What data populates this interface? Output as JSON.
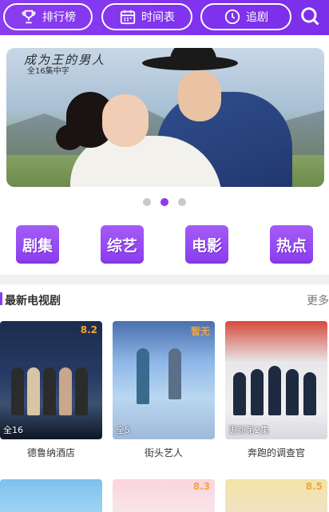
{
  "header": {
    "buttons": [
      {
        "label": "排行榜",
        "icon": "trophy-icon"
      },
      {
        "label": "时间表",
        "icon": "calendar-icon"
      },
      {
        "label": "追剧",
        "icon": "clock-icon"
      }
    ],
    "search_icon": "search-icon",
    "colors": {
      "accent": "#8a3cf0"
    }
  },
  "banner": {
    "title": "成为王的男人",
    "subtitle": "全16集中字",
    "dots": {
      "count": 3,
      "active_index": 1
    }
  },
  "categories": [
    {
      "label": "剧集"
    },
    {
      "label": "综艺"
    },
    {
      "label": "电影"
    },
    {
      "label": "热点"
    }
  ],
  "section": {
    "title": "最新电视剧",
    "more": "更多"
  },
  "cards": [
    {
      "title": "德鲁纳酒店",
      "badge": "全16",
      "score": "8.2"
    },
    {
      "title": "街头艺人",
      "badge": "全5",
      "score": "暂无"
    },
    {
      "title": "奔跑的调查官",
      "badge": "更新第2集",
      "score": ""
    }
  ],
  "cards_row2": [
    {
      "score": ""
    },
    {
      "score": "8.3"
    },
    {
      "score": "8.5"
    }
  ]
}
